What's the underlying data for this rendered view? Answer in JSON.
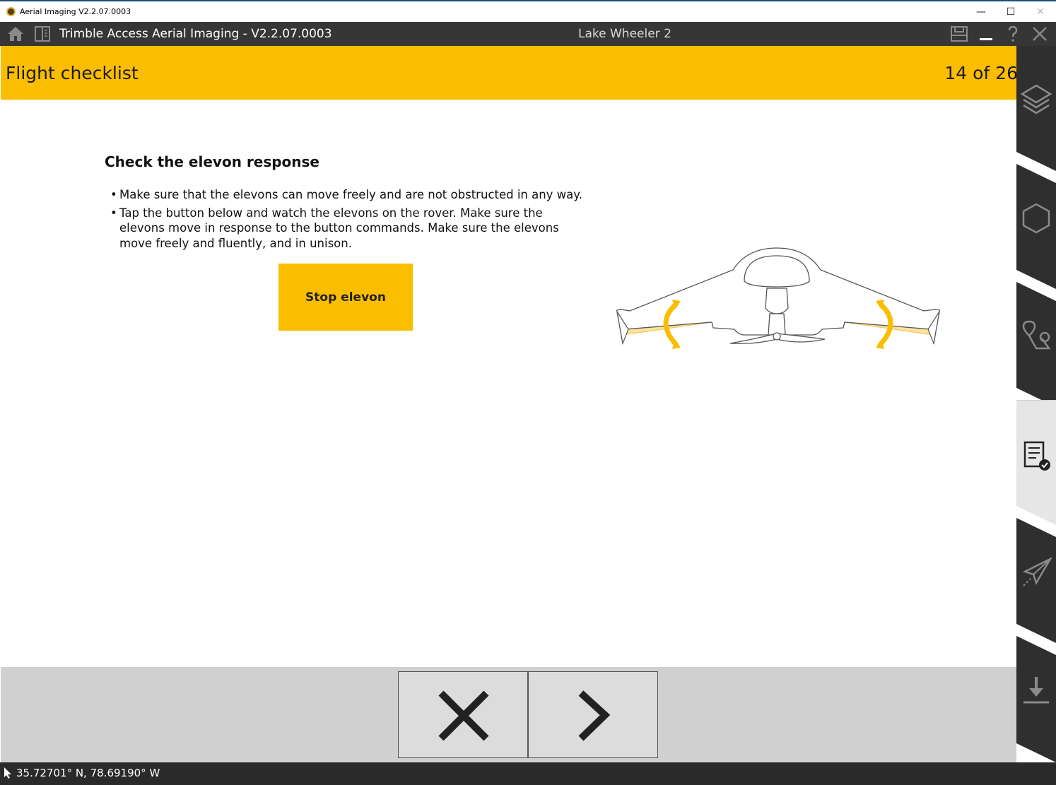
{
  "window": {
    "title": "Aerial Imaging V2.2.07.0003",
    "minimize": "—",
    "maximize": "☐",
    "close": "✕"
  },
  "header": {
    "title": "Trimble Access Aerial Imaging - V2.2.07.0003",
    "project": "Lake Wheeler 2"
  },
  "banner": {
    "title": "Flight checklist",
    "step": "14 of 26"
  },
  "check": {
    "heading": "Check the elevon response",
    "bullets": [
      "Make sure that the elevons can move freely and are not obstructed in any way.",
      "Tap the button below and watch the elevons on the rover. Make sure the elevons move in response to the button commands. Make sure the elevons move freely and fluently, and in unison."
    ],
    "button_label": "Stop elevon"
  },
  "footer": {
    "cancel_icon": "close-icon",
    "next_icon": "chevron-right-icon"
  },
  "status": {
    "coordinates": "35.72701° N, 78.69190° W"
  },
  "sidebar": {
    "items": [
      {
        "icon": "layers-icon",
        "active": false
      },
      {
        "icon": "hexagon-icon",
        "active": false
      },
      {
        "icon": "waypoint-icon",
        "active": false
      },
      {
        "icon": "checklist-icon",
        "active": true
      },
      {
        "icon": "paper-plane-icon",
        "active": false
      },
      {
        "icon": "download-icon",
        "active": false
      }
    ]
  },
  "colors": {
    "accent": "#fbbd00",
    "header": "#363636",
    "sidebar": "#2f2f2f",
    "sidebar_active": "#e6e6e6"
  }
}
